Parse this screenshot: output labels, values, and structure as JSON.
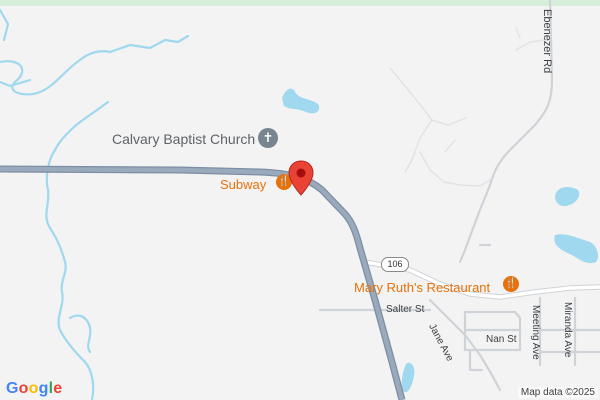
{
  "map": {
    "pois": {
      "church": "Calvary Baptist Church",
      "subway": "Subway",
      "mary_ruths": "Mary Ruth's Restaurant"
    },
    "streets": {
      "ebenezer": "Ebenezer Rd",
      "salter": "Salter St",
      "jane": "Jane Ave",
      "nan": "Nan St",
      "meeting": "Meeting Ave",
      "miranda": "Miranda Ave"
    },
    "route_shield": "106",
    "attribution": "Map data ©2025",
    "icons": {
      "church": "church-cross-icon",
      "restaurant": "fork-knife-icon",
      "pin": "location-pin-icon"
    }
  },
  "logo": [
    "G",
    "o",
    "o",
    "g",
    "l",
    "e"
  ],
  "colors": {
    "water": "#9fd8ef",
    "river": "#8fd3ec",
    "highway": "#8d9db1",
    "road": "#ffffff",
    "poi_orange": "#e8710a",
    "pin_red": "#ea4335"
  }
}
